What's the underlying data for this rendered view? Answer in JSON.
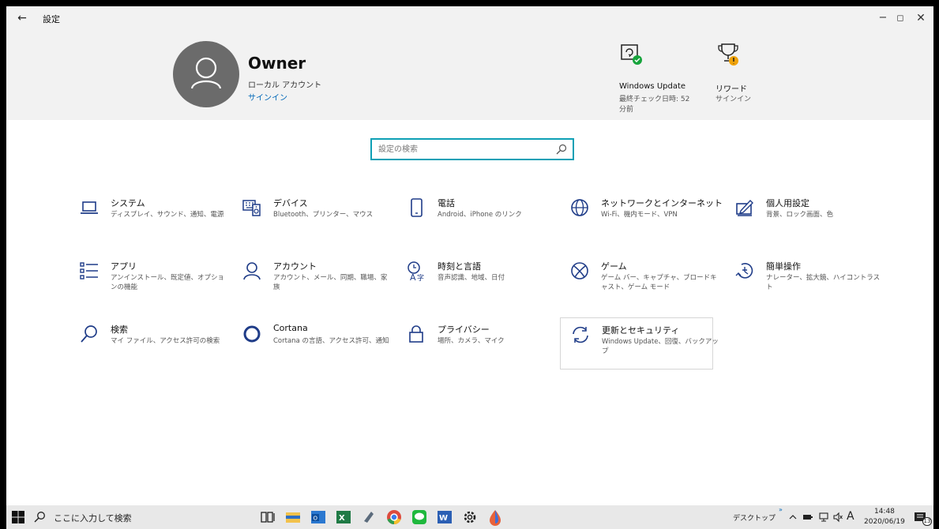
{
  "window": {
    "title": "設定",
    "back": "←",
    "min": "−",
    "max": "◻",
    "close": "✕"
  },
  "account": {
    "name": "Owner",
    "type": "ローカル アカウント",
    "signin": "サインイン"
  },
  "header_items": [
    {
      "title": "Windows Update",
      "sub1": "最終チェック日時: 52",
      "sub2": "分前"
    },
    {
      "title": "リワード",
      "sub1": "サインイン"
    }
  ],
  "search": {
    "placeholder": "設定の検索"
  },
  "tiles": [
    {
      "name": "システム",
      "desc": "ディスプレイ、サウンド、通知、電源",
      "icon": "laptop-icon"
    },
    {
      "name": "デバイス",
      "desc": "Bluetooth、プリンター、マウス",
      "icon": "keyboard-speaker-icon"
    },
    {
      "name": "電話",
      "desc": "Android、iPhone のリンク",
      "icon": "phone-icon"
    },
    {
      "name": "ネットワークとインターネット",
      "desc": "Wi-Fi、機内モード、VPN",
      "icon": "globe-icon"
    },
    {
      "name": "個人用設定",
      "desc": "背景、ロック画面、色",
      "icon": "pen-tablet-icon"
    },
    {
      "name": "アプリ",
      "desc": "アンインストール、既定値、オプションの機能",
      "icon": "app-list-icon"
    },
    {
      "name": "アカウント",
      "desc": "アカウント、メール、同期、職場、家族",
      "icon": "person-icon"
    },
    {
      "name": "時刻と言語",
      "desc": "音声認識、地域、日付",
      "icon": "time-language-icon"
    },
    {
      "name": "ゲーム",
      "desc": "ゲーム バー、キャプチャ、ブロードキャスト、ゲーム モード",
      "icon": "xbox-icon"
    },
    {
      "name": "簡単操作",
      "desc": "ナレーター、拡大鏡、ハイコントラスト",
      "icon": "ease-of-access-icon"
    },
    {
      "name": "検索",
      "desc": "マイ ファイル、アクセス許可の検索",
      "icon": "search-icon"
    },
    {
      "name": "Cortana",
      "desc": "Cortana の言語、アクセス許可、通知",
      "icon": "cortana-icon"
    },
    {
      "name": "プライバシー",
      "desc": "場所、カメラ、マイク",
      "icon": "lock-icon"
    },
    {
      "name": "更新とセキュリティ",
      "desc": "Windows Update、回復、バックアップ",
      "icon": "sync-icon"
    }
  ],
  "taskbar": {
    "search_text": "ここに入力して検索",
    "desktop_label": "デスクトップ",
    "chevron": "»",
    "ime": "A",
    "time": "14:48",
    "date": "2020/06/19",
    "notification_count": "13"
  },
  "colors": {
    "accent": "#0067b8",
    "search_border": "#0ea0b5",
    "header_bg": "#f2f2f2"
  }
}
